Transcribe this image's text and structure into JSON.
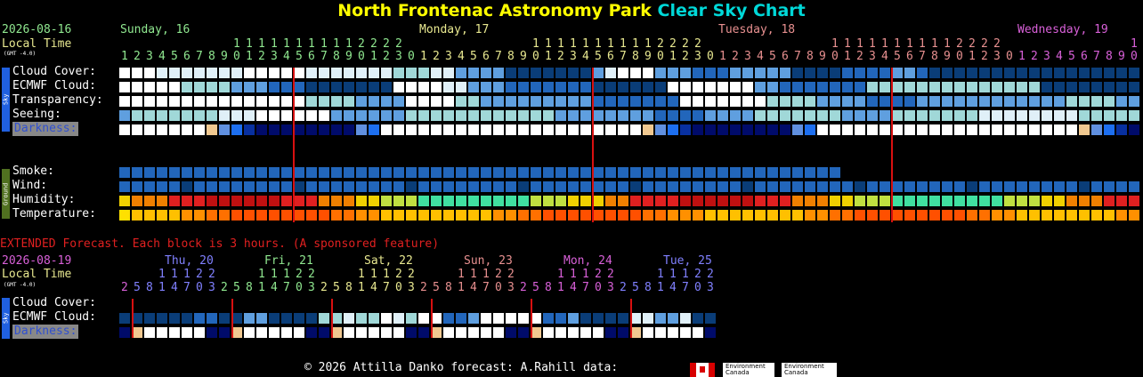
{
  "title": {
    "part1": "North Frontenac Astronomy Park",
    "part2": "Clear Sky Chart"
  },
  "top": {
    "date": "2026-08-16",
    "local_time": "Local Time",
    "gmt": "(GMT -4.0)",
    "days": [
      {
        "label": "Sunday, 16",
        "color": "#90e890",
        "start": 0
      },
      {
        "label": "Monday, 17",
        "color": "#e8e890",
        "start": 24
      },
      {
        "label": "Tuesday, 18",
        "color": "#e89090",
        "start": 48
      },
      {
        "label": "Wednesday, 19",
        "color": "#d860d8",
        "start": 72
      }
    ],
    "hours_tens": [
      "1",
      "1",
      "1",
      "1",
      "1",
      "1",
      "1",
      "1",
      "1",
      "1",
      "1",
      "2",
      "2",
      "2",
      "2"
    ],
    "hours": [
      "1",
      "2",
      "3",
      "4",
      "5",
      "6",
      "7",
      "8",
      "9",
      "0",
      "1",
      "2",
      "3",
      "0"
    ],
    "sky_label": "Sky",
    "ground_label": "Ground",
    "rows": {
      "cloud": "Cloud Cover:",
      "ecmwf": "ECMWF Cloud:",
      "transparency": "Transparency:",
      "seeing": "Seeing:",
      "darkness": "Darkness:",
      "smoke": "Smoke:",
      "wind": "Wind:",
      "humidity": "Humidity:",
      "temperature": "Temperature:"
    }
  },
  "extended": {
    "banner": "EXTENDED Forecast. Each block is 3 hours. (A sponsored feature)",
    "date": "2026-08-19",
    "local_time": "Local Time",
    "gmt": "(GMT -4.0)",
    "days": [
      {
        "label": "Thu, 20",
        "color": "#8080ff"
      },
      {
        "label": "Fri, 21",
        "color": "#90e890"
      },
      {
        "label": "Sat, 22",
        "color": "#e8e890"
      },
      {
        "label": "Sun, 23",
        "color": "#e89090"
      },
      {
        "label": "Mon, 24",
        "color": "#d860d8"
      },
      {
        "label": "Tue, 25",
        "color": "#8080ff"
      }
    ],
    "rows": {
      "cloud": "Cloud Cover:",
      "ecmwf": "ECMWF Cloud:",
      "darkness": "Darkness:"
    }
  },
  "footer": {
    "text": "© 2026 Attilla Danko  forecast: A.Rahill  data:",
    "env1": "Environment",
    "env2": "Canada"
  },
  "colors": {
    "white": "#ffffff",
    "light": "#e0f0f8",
    "teal": "#a0d8d8",
    "mid": "#5f9fdf",
    "blue": "#2266bb",
    "dark": "#0a3d78",
    "midnight_line": "#d81010"
  },
  "chart_data": {
    "type": "heatmap",
    "title": "North Frontenac Astronomy Park Clear Sky Chart",
    "rows": [
      "Cloud Cover",
      "ECMWF Cloud",
      "Transparency",
      "Seeing",
      "Darkness",
      "Smoke",
      "Wind",
      "Humidity",
      "Temperature"
    ],
    "hours_start": 1,
    "hours_count": 82,
    "cloud": "WWWLLLLLLLWWWWWLLLLLLLTTTLLMMMMDDDDDDDMLWWWMMMBBBMMMMMDDDDBBBBMMBDDDDDDDDDDDDDDDDD",
    "ecmwf": "WWWWWTTTTMMMBBBDDDDDDDWWWWLLMMMBBBBBBBDDDDDDWWWWWWWMMBBBBBBBTTTTTTTTTTTTTTDDDDDDDDD",
    "transp": "WWWWWWWWWWWWWWWTTTTMMMMWWWWTTMMMMMMMMMBBBBBBBWWWWWWWTTTTMMMMBBBBMMMMMMMMMMMMTTTTMMMMM",
    "seeing": "MTTTTTTTLLLWWWWWWMMMMMMTTTTTTTTTTTTMMMMMMMMBBBBMMMMTTTTTTTMMMMTTTTTTTLLLLLLLLTTTTTTTT",
    "dark": "WWWWWWWKLBDNNNNNNNNLBWWWWWWWWWWWWWWWWWWWWWKLBDNNNNNNNNLBWWWWWWWWWWWWWWWWWWWWWKLBDNN",
    "smoke_len": 58,
    "humidity_scale": [
      "#40e0a0",
      "#c0e040",
      "#f0d000",
      "#f08000",
      "#e02020",
      "#c01010"
    ],
    "temp_scale": [
      "#ff5000",
      "#ff7000",
      "#ff9000",
      "#ffc000",
      "#ffe000"
    ],
    "ext_cloud": "DDDDDDBBDDMMDDDDTTLTTWLTWWBBMWWWWWBBMDDDDLLMMLDDWWW",
    "ext_ecmwf": "",
    "ext_dark": "NKWWWWWNNKWWWWWNNKWWWWWNNKWWWWWNNKWWWWWNNKWWWWWNNK"
  }
}
